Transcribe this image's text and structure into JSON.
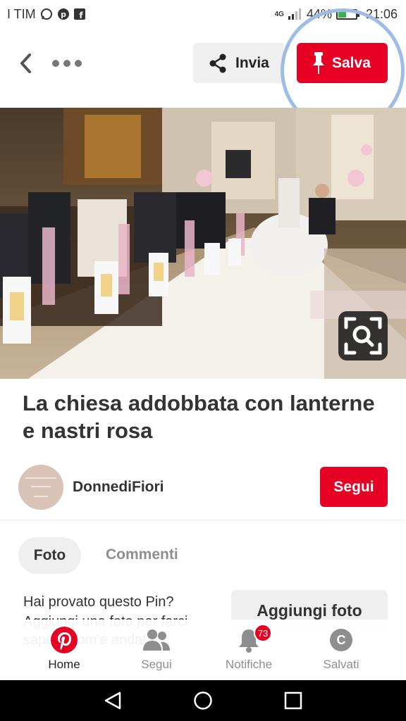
{
  "status_bar": {
    "carrier": "I TIM",
    "network": "4G",
    "battery_percent": "44%",
    "battery_level": 0.44,
    "time": "21:06"
  },
  "top_bar": {
    "share_label": "Invia",
    "save_label": "Salva"
  },
  "pin": {
    "title": "La chiesa addobbata con lanterne e nastri rosa",
    "author": "DonnediFiori",
    "follow_label": "Segui"
  },
  "tabs": {
    "foto": "Foto",
    "comments": "Commenti"
  },
  "tried_section": {
    "question": "Hai provato questo Pin?",
    "subtext": "Aggiungi una foto per farci sapere com'è andata!",
    "button": "Aggiungi foto"
  },
  "bottom_nav": {
    "items": [
      {
        "label": "Home",
        "active": true
      },
      {
        "label": "Segui",
        "active": false
      },
      {
        "label": "Notifiche",
        "active": false,
        "badge": "73"
      },
      {
        "label": "Salvati",
        "active": false,
        "avatar_letter": "C"
      }
    ]
  },
  "colors": {
    "brand_red": "#e60023",
    "highlight_ring": "#9dbde6",
    "battery_green": "#37b34a"
  }
}
